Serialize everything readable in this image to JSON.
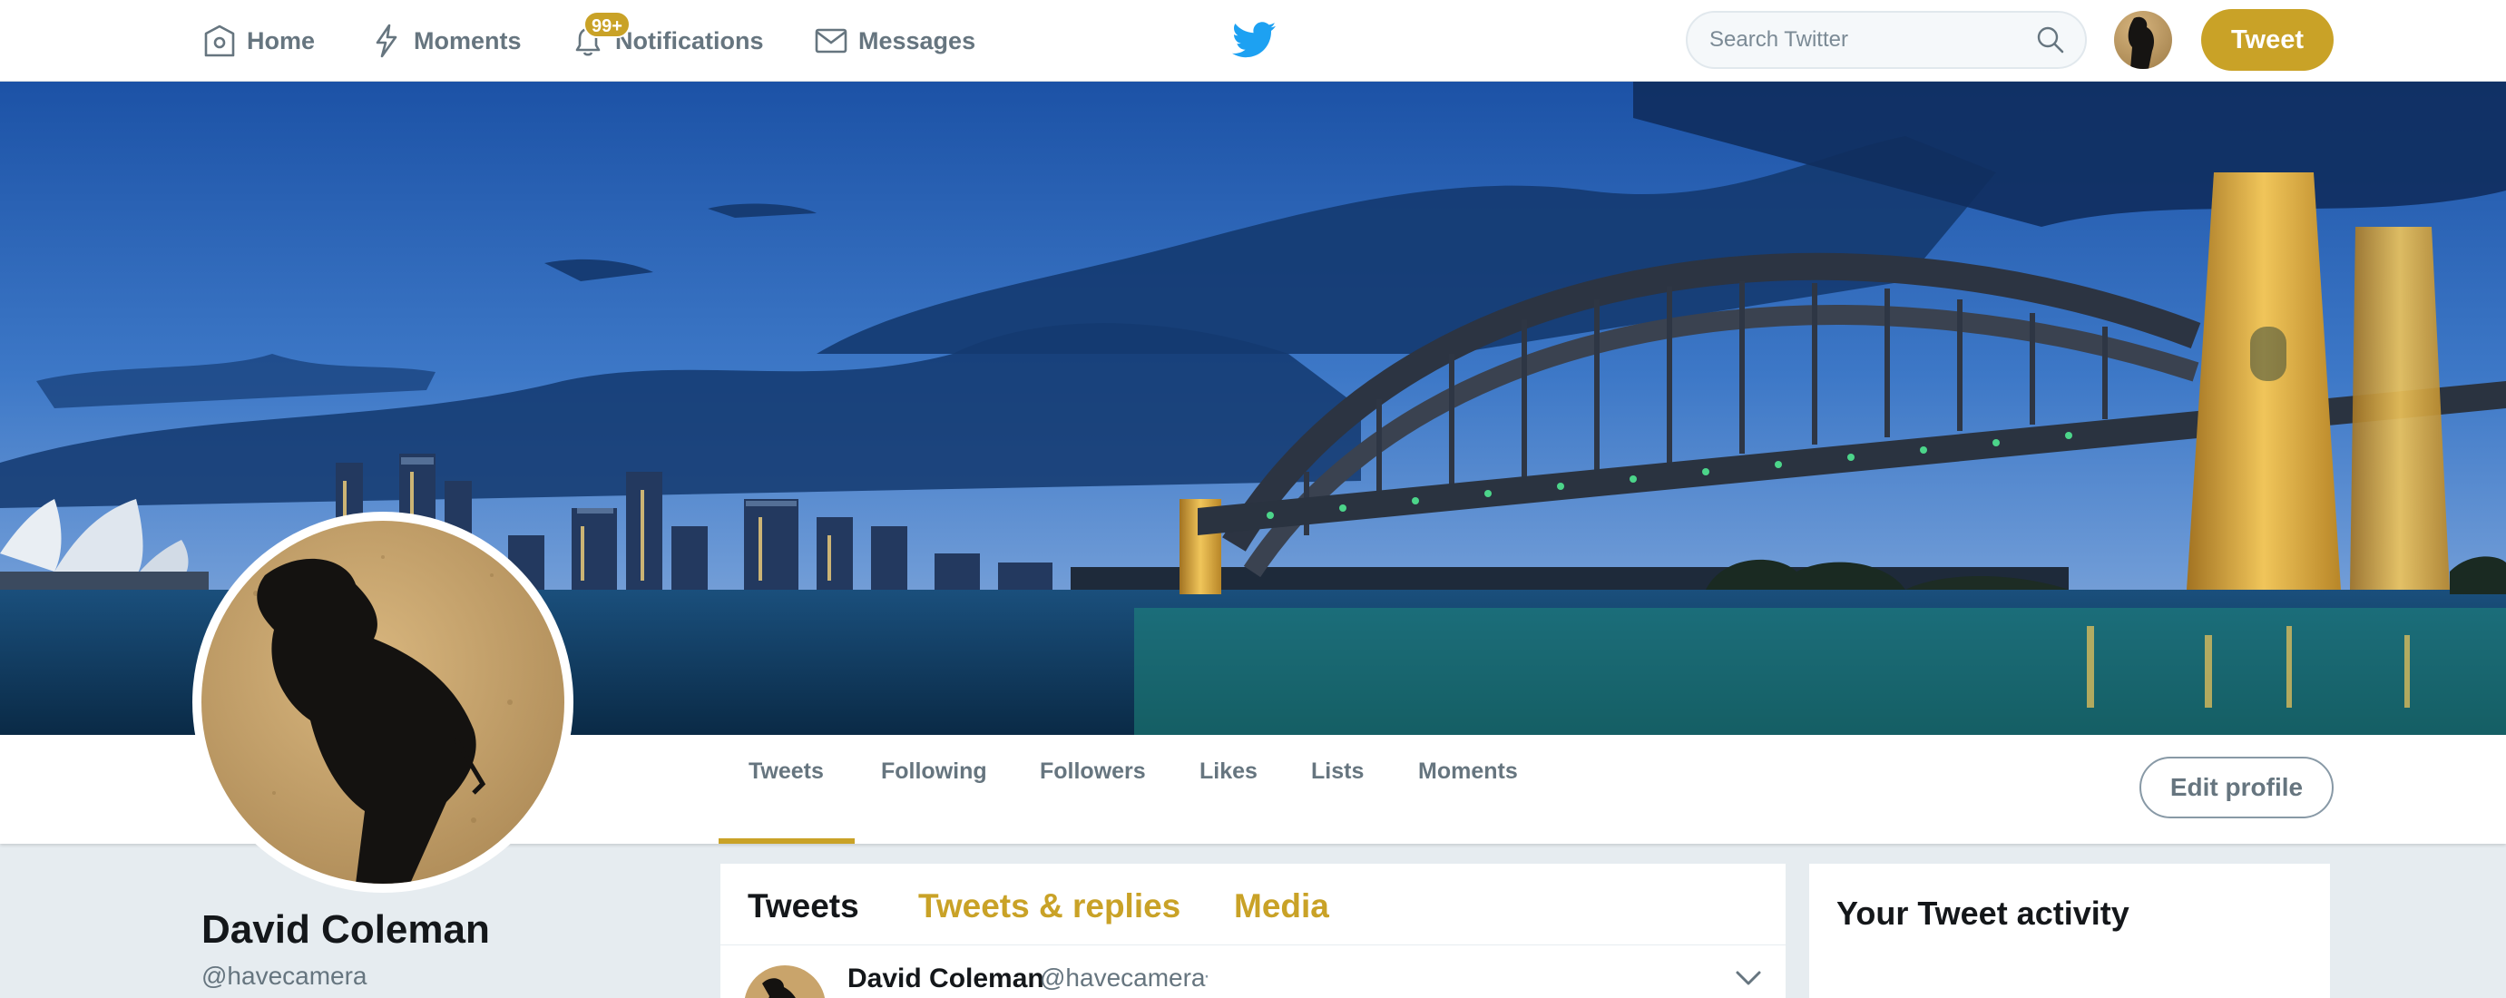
{
  "topnav": {
    "home_label": "Home",
    "moments_label": "Moments",
    "notifications_label": "Notifications",
    "notifications_badge": "99+",
    "messages_label": "Messages",
    "search_placeholder": "Search Twitter",
    "tweet_button": "Tweet",
    "icons": [
      "home-icon",
      "lightning-icon",
      "bell-icon",
      "envelope-icon",
      "twitter-bird-icon",
      "search-icon"
    ]
  },
  "profile_nav": {
    "tabs": [
      "Tweets",
      "Following",
      "Followers",
      "Likes",
      "Lists",
      "Moments"
    ],
    "active_tab": "Tweets",
    "edit_profile_label": "Edit profile"
  },
  "profile": {
    "name": "David Coleman",
    "handle": "@havecamera"
  },
  "timeline": {
    "tabs": [
      "Tweets",
      "Tweets & replies",
      "Media"
    ],
    "active_tab": "Tweets",
    "first_tweet": {
      "author_name": "David Coleman",
      "author_handle": "@havecamera",
      "separator": "·"
    }
  },
  "sidebar": {
    "activity_title": "Your Tweet activity"
  },
  "colors": {
    "accent": "#c9a227",
    "twitter_blue": "#1da1f2",
    "muted_text": "#66757f",
    "page_bg": "#e6ecf0"
  }
}
